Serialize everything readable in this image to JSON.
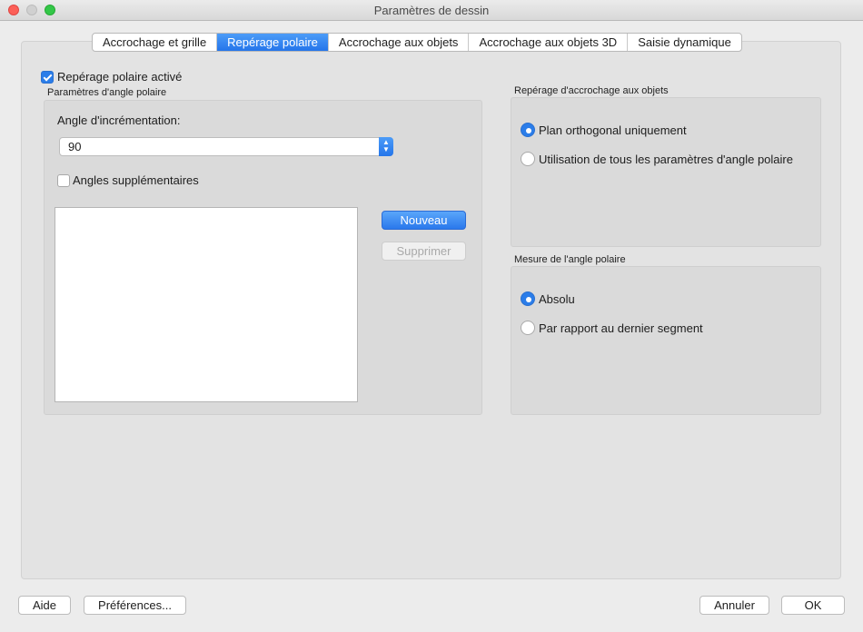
{
  "window": {
    "title": "Paramètres de dessin"
  },
  "tabs": [
    {
      "label": "Accrochage et grille"
    },
    {
      "label": "Repérage polaire"
    },
    {
      "label": "Accrochage aux objets"
    },
    {
      "label": "Accrochage aux objets 3D"
    },
    {
      "label": "Saisie dynamique"
    }
  ],
  "active_tab": "Repérage polaire",
  "polar": {
    "enabled_label": "Repérage polaire activé",
    "enabled": true,
    "settings_title": "Paramètres d'angle polaire",
    "increment_label": "Angle d'incrémentation:",
    "increment_value": "90",
    "additional_label": "Angles supplémentaires",
    "additional_checked": false,
    "new_button": "Nouveau",
    "delete_button": "Supprimer"
  },
  "snap_tracking": {
    "title": "Repérage d'accrochage aux objets",
    "options": [
      {
        "label": "Plan orthogonal uniquement",
        "selected": true
      },
      {
        "label": "Utilisation de tous les paramètres d'angle polaire",
        "selected": false
      }
    ]
  },
  "angle_measure": {
    "title": "Mesure de l'angle polaire",
    "options": [
      {
        "label": "Absolu",
        "selected": true
      },
      {
        "label": "Par rapport au dernier segment",
        "selected": false
      }
    ]
  },
  "footer": {
    "help": "Aide",
    "preferences": "Préférences...",
    "cancel": "Annuler",
    "ok": "OK"
  },
  "colors": {
    "accent": "#2b7de9"
  }
}
